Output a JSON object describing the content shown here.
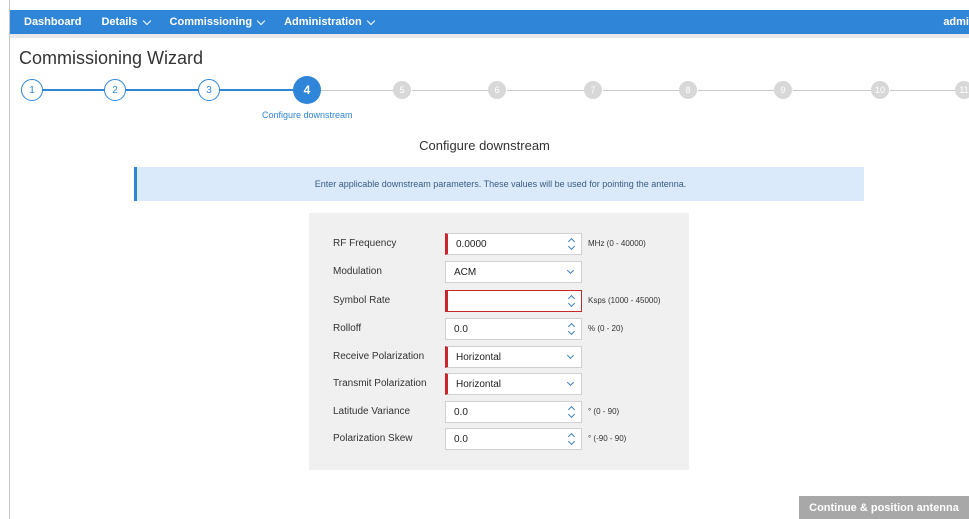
{
  "nav": {
    "items": [
      {
        "label": "Dashboard",
        "dropdown": false
      },
      {
        "label": "Details",
        "dropdown": true
      },
      {
        "label": "Commissioning",
        "dropdown": true
      },
      {
        "label": "Administration",
        "dropdown": true
      }
    ],
    "user": "admi"
  },
  "wizard": {
    "title": "Commissioning Wizard",
    "current_step": 4,
    "steps": [
      "1",
      "2",
      "3",
      "4",
      "5",
      "6",
      "7",
      "8",
      "9",
      "10",
      "11"
    ],
    "current_caption": "Configure downstream"
  },
  "section": {
    "title": "Configure downstream",
    "info": "Enter applicable downstream parameters. These values will be used for pointing the antenna."
  },
  "form": {
    "fields": [
      {
        "label": "RF Frequency",
        "value": "0.0000",
        "unit": "MHz (0 - 40000)",
        "control": "spinner",
        "state": "required"
      },
      {
        "label": "Modulation",
        "value": "ACM",
        "unit": "",
        "control": "select",
        "state": "normal"
      },
      {
        "label": "Symbol Rate",
        "value": "",
        "unit": "Ksps (1000 - 45000)",
        "control": "spinner",
        "state": "error"
      },
      {
        "label": "Rolloff",
        "value": "0.0",
        "unit": "% (0 - 20)",
        "control": "spinner",
        "state": "normal"
      },
      {
        "label": "Receive Polarization",
        "value": "Horizontal",
        "unit": "",
        "control": "select",
        "state": "required"
      },
      {
        "label": "Transmit Polarization",
        "value": "Horizontal",
        "unit": "",
        "control": "select",
        "state": "required"
      },
      {
        "label": "Latitude Variance",
        "value": "0.0",
        "unit": "° (0 - 90)",
        "control": "spinner",
        "state": "normal"
      },
      {
        "label": "Polarization Skew",
        "value": "0.0",
        "unit": "° (-90 - 90)",
        "control": "spinner",
        "state": "normal"
      }
    ]
  },
  "actions": {
    "continue_label": "Continue & position antenna"
  },
  "colors": {
    "primary": "#2f86d8",
    "error": "#c8282d",
    "banner_bg": "#dbeafa",
    "panel_bg": "#f0f0f0",
    "button_disabled": "#a8a8a8"
  }
}
